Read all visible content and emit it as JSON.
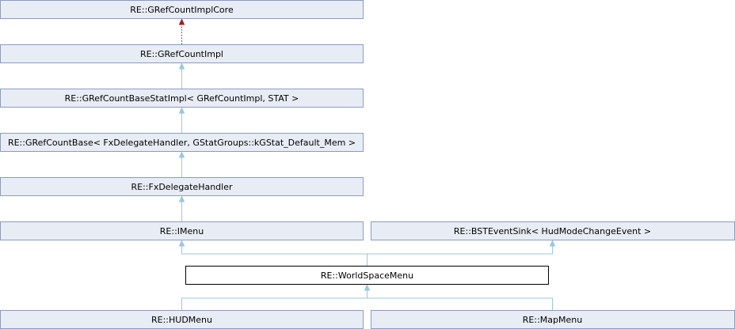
{
  "diagram": {
    "nodes": {
      "gref_core": "RE::GRefCountImplCore",
      "gref_impl": "RE::GRefCountImpl",
      "gref_base_stat": "RE::GRefCountBaseStatImpl< GRefCountImpl, STAT >",
      "gref_base": "RE::GRefCountBase< FxDelegateHandler, GStatGroups::kGStat_Default_Mem >",
      "fx_delegate": "RE::FxDelegateHandler",
      "imenu": "RE::IMenu",
      "bst_event_sink": "RE::BSTEventSink< HudModeChangeEvent >",
      "world_space_menu": "RE::WorldSpaceMenu",
      "hud_menu": "RE::HUDMenu",
      "map_menu": "RE::MapMenu"
    },
    "current_node": "world_space_menu",
    "edges": [
      {
        "from": "gref_impl",
        "to": "gref_core",
        "kind": "template"
      },
      {
        "from": "gref_base_stat",
        "to": "gref_impl",
        "kind": "inheritance"
      },
      {
        "from": "gref_base",
        "to": "gref_base_stat",
        "kind": "inheritance"
      },
      {
        "from": "fx_delegate",
        "to": "gref_base",
        "kind": "inheritance"
      },
      {
        "from": "imenu",
        "to": "fx_delegate",
        "kind": "inheritance"
      },
      {
        "from": "world_space_menu",
        "to": "imenu",
        "kind": "inheritance"
      },
      {
        "from": "world_space_menu",
        "to": "bst_event_sink",
        "kind": "inheritance"
      },
      {
        "from": "hud_menu",
        "to": "world_space_menu",
        "kind": "inheritance"
      },
      {
        "from": "map_menu",
        "to": "world_space_menu",
        "kind": "inheritance"
      }
    ],
    "colors": {
      "node_fill": "#e8edf5",
      "node_border": "#8c9cbf",
      "current_fill": "#ffffff",
      "current_border": "#000000",
      "inheritance_edge": "#9ac7dd",
      "template_edge": "#9a2222"
    }
  }
}
